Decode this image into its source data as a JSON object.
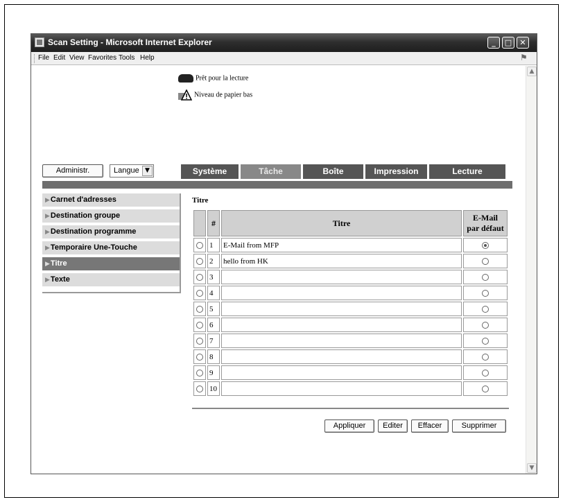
{
  "window": {
    "title": "Scan Setting - Microsoft Internet Explorer"
  },
  "titlebar_buttons": [
    "_",
    "□",
    "✕"
  ],
  "menu": [
    "File",
    "Edit",
    "View",
    "Favorites",
    "Tools",
    "Help"
  ],
  "status": [
    {
      "icon": "printer-icon",
      "text": "Prêt pour la lecture"
    },
    {
      "icon": "warning-icon",
      "text": "Niveau de papier bas"
    }
  ],
  "admin_button": "Administr.",
  "language_select": "Langue",
  "tabs": [
    "Système",
    "Tâche",
    "Boîte",
    "Impression",
    "Lecture"
  ],
  "active_tab": "Tâche",
  "nav": [
    "Carnet d'adresses",
    "Destination groupe",
    "Destination programme",
    "Temporaire Une-Touche",
    "Titre",
    "Texte"
  ],
  "active_nav": "Titre",
  "section_title": "Titre",
  "table": {
    "headers": {
      "num": "#",
      "title": "Titre",
      "default": "E-Mail par défaut"
    },
    "rows": [
      {
        "num": "1",
        "title": "E-Mail from MFP",
        "default": true
      },
      {
        "num": "2",
        "title": "hello from HK",
        "default": false
      },
      {
        "num": "3",
        "title": "",
        "default": false
      },
      {
        "num": "4",
        "title": "",
        "default": false
      },
      {
        "num": "5",
        "title": "",
        "default": false
      },
      {
        "num": "6",
        "title": "",
        "default": false
      },
      {
        "num": "7",
        "title": "",
        "default": false
      },
      {
        "num": "8",
        "title": "",
        "default": false
      },
      {
        "num": "9",
        "title": "",
        "default": false
      },
      {
        "num": "10",
        "title": "",
        "default": false
      }
    ]
  },
  "actions": [
    "Appliquer",
    "Editer",
    "Effacer",
    "Supprimer"
  ]
}
